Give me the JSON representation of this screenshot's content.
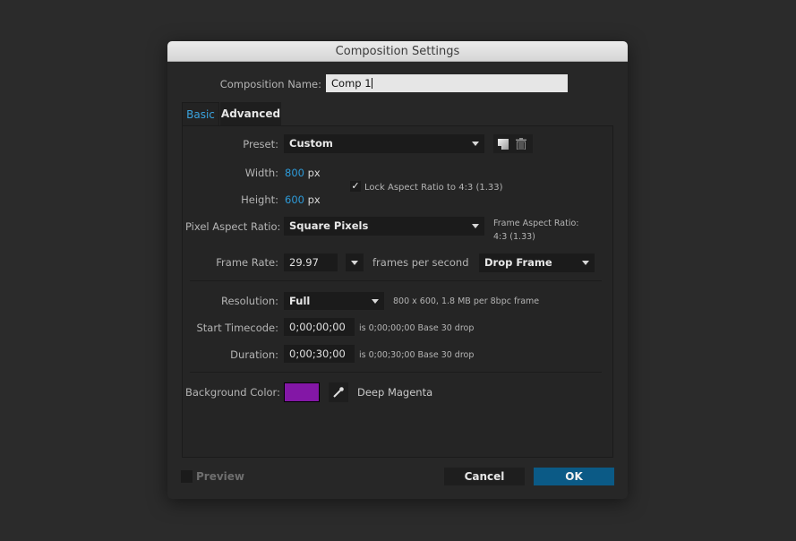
{
  "dialog": {
    "title": "Composition Settings",
    "name_label": "Composition Name:",
    "name_value": "Comp 1",
    "tabs": [
      {
        "label": "Basic",
        "active": true
      },
      {
        "label": "Advanced",
        "active": false
      }
    ],
    "basic": {
      "preset_label": "Preset:",
      "preset_value": "Custom",
      "preset_icons": [
        "save-preset-icon",
        "delete-preset-icon"
      ],
      "width_label": "Width:",
      "width_value": "800",
      "width_unit": "px",
      "height_label": "Height:",
      "height_value": "600",
      "height_unit": "px",
      "lock_aspect_checked": true,
      "lock_aspect_label": "Lock Aspect Ratio to 4:3 (1.33)",
      "par_label": "Pixel Aspect Ratio:",
      "par_value": "Square Pixels",
      "frame_aspect_label": "Frame Aspect Ratio:",
      "frame_aspect_value": "4:3 (1.33)",
      "frame_rate_label": "Frame Rate:",
      "frame_rate_value": "29.97",
      "fps_label": "frames per second",
      "drop_frame_value": "Drop Frame",
      "resolution_label": "Resolution:",
      "resolution_value": "Full",
      "resolution_info": "800 x 600, 1.8 MB per 8bpc frame",
      "start_tc_label": "Start Timecode:",
      "start_tc_value": "0;00;00;00",
      "start_tc_info": "is 0;00;00;00  Base 30  drop",
      "duration_label": "Duration:",
      "duration_value": "0;00;30;00",
      "duration_info": "is 0;00;30;00  Base 30  drop",
      "bg_label": "Background Color:",
      "bg_color": "#8317a6",
      "bg_color_name": "Deep Magenta"
    },
    "footer": {
      "preview_label": "Preview",
      "preview_checked": false,
      "cancel_label": "Cancel",
      "ok_label": "OK"
    },
    "colors": {
      "accent_blue": "#2d9ad8",
      "ok_button": "#0b5a86"
    }
  }
}
